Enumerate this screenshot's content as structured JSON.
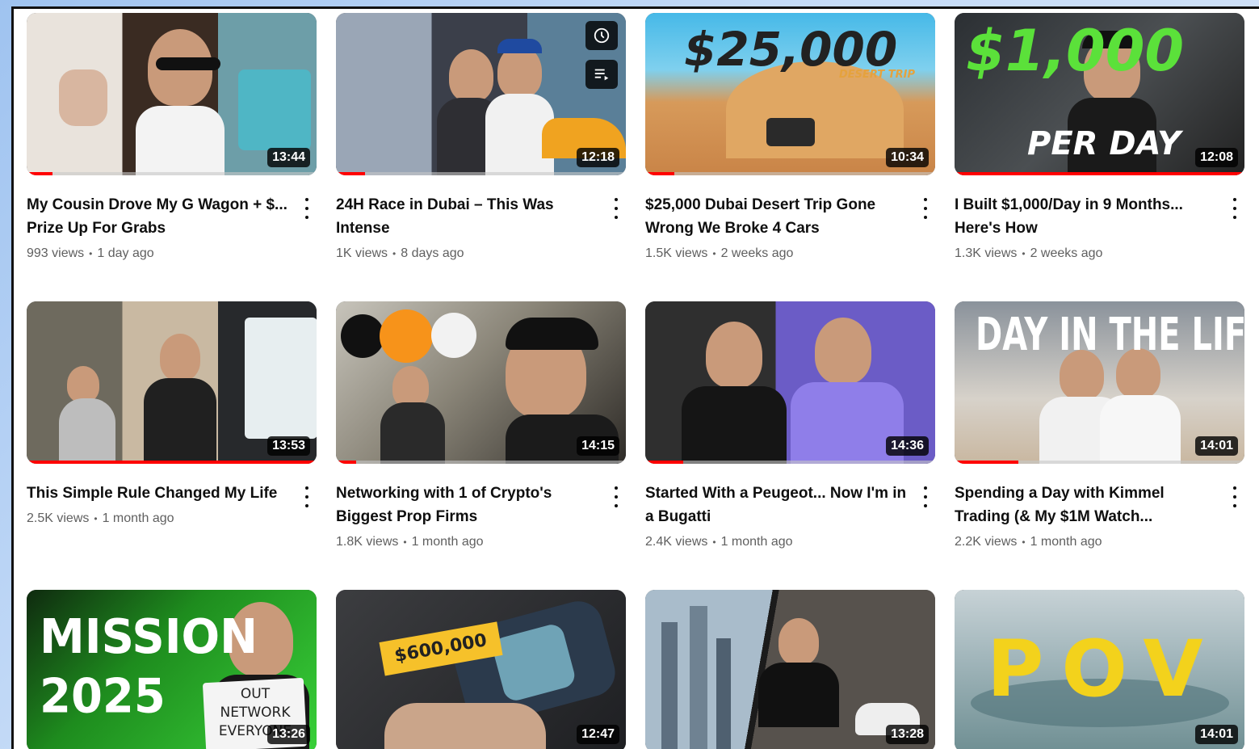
{
  "videos": [
    {
      "title": "My Cousin Drove My G Wagon + $... Prize Up For Grabs",
      "views": "993 views",
      "age": "1 day ago",
      "duration": "13:44",
      "progress": 0.09
    },
    {
      "title": "24H Race in Dubai – This Was Intense",
      "views": "1K views",
      "age": "8 days ago",
      "duration": "12:18",
      "progress": 0.1
    },
    {
      "title": "$25,000 Dubai Desert Trip Gone Wrong We Broke 4 Cars",
      "views": "1.5K views",
      "age": "2 weeks ago",
      "duration": "10:34",
      "progress": 0.1,
      "overlay_main": "$25,000",
      "overlay_sub": "DESERT TRIP"
    },
    {
      "title": "I Built $1,000/Day in 9 Months... Here's How",
      "views": "1.3K views",
      "age": "2 weeks ago",
      "duration": "12:08",
      "progress": 1.0,
      "overlay_main": "$1,000",
      "overlay_sub": "PER DAY"
    },
    {
      "title": "This Simple Rule Changed My Life",
      "views": "2.5K views",
      "age": "1 month ago",
      "duration": "13:53",
      "progress": 1.0
    },
    {
      "title": "Networking with 1 of Crypto's Biggest Prop Firms",
      "views": "1.8K views",
      "age": "1 month ago",
      "duration": "14:15",
      "progress": 0.07
    },
    {
      "title": "Started With a Peugeot... Now I'm in a Bugatti",
      "views": "2.4K views",
      "age": "1 month ago",
      "duration": "14:36",
      "progress": 0.13
    },
    {
      "title": "Spending a Day with Kimmel Trading (& My $1M Watch...",
      "views": "2.2K views",
      "age": "1 month ago",
      "duration": "14:01",
      "progress": 0.22,
      "overlay_main": "DAY IN THE LIFE"
    },
    {
      "title": "",
      "views": "",
      "age": "",
      "duration": "13:26",
      "progress": 0.0,
      "overlay_main": "MISSION 2025",
      "overlay_sub": "OUT NETWORK EVERYONE"
    },
    {
      "title": "",
      "views": "",
      "age": "",
      "duration": "12:47",
      "progress": 0.0,
      "overlay_main": "$600,000"
    },
    {
      "title": "",
      "views": "",
      "age": "",
      "duration": "13:28",
      "progress": 0.0
    },
    {
      "title": "",
      "views": "",
      "age": "",
      "duration": "14:01",
      "progress": 0.0,
      "overlay_main": "POV"
    }
  ],
  "icons": {
    "watch_later": "clock-icon",
    "add_to_queue": "queue-icon",
    "more_actions": "kebab-icon"
  },
  "colors": {
    "progress": "#ff0000",
    "title": "#0f0f0f",
    "meta": "#606060",
    "duration_bg": "#000000"
  }
}
